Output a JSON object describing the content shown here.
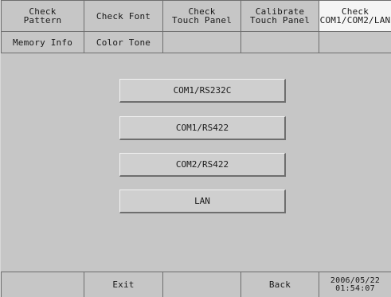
{
  "tabs_row1": [
    {
      "label": "Check\nPattern"
    },
    {
      "label": "Check Font"
    },
    {
      "label": "Check\nTouch Panel"
    },
    {
      "label": "Calibrate\nTouch Panel"
    },
    {
      "label": "Check\nCOM1/COM2/LAN"
    }
  ],
  "tabs_row2": [
    {
      "label": "Memory Info"
    },
    {
      "label": "Color Tone"
    },
    {
      "label": ""
    },
    {
      "label": ""
    },
    {
      "label": ""
    }
  ],
  "buttons": [
    {
      "label": "COM1/RS232C"
    },
    {
      "label": "COM1/RS422"
    },
    {
      "label": "COM2/RS422"
    },
    {
      "label": "LAN"
    }
  ],
  "footer": {
    "exit_label": "Exit",
    "back_label": "Back",
    "datetime": "2006/05/22\n01:54:07"
  }
}
